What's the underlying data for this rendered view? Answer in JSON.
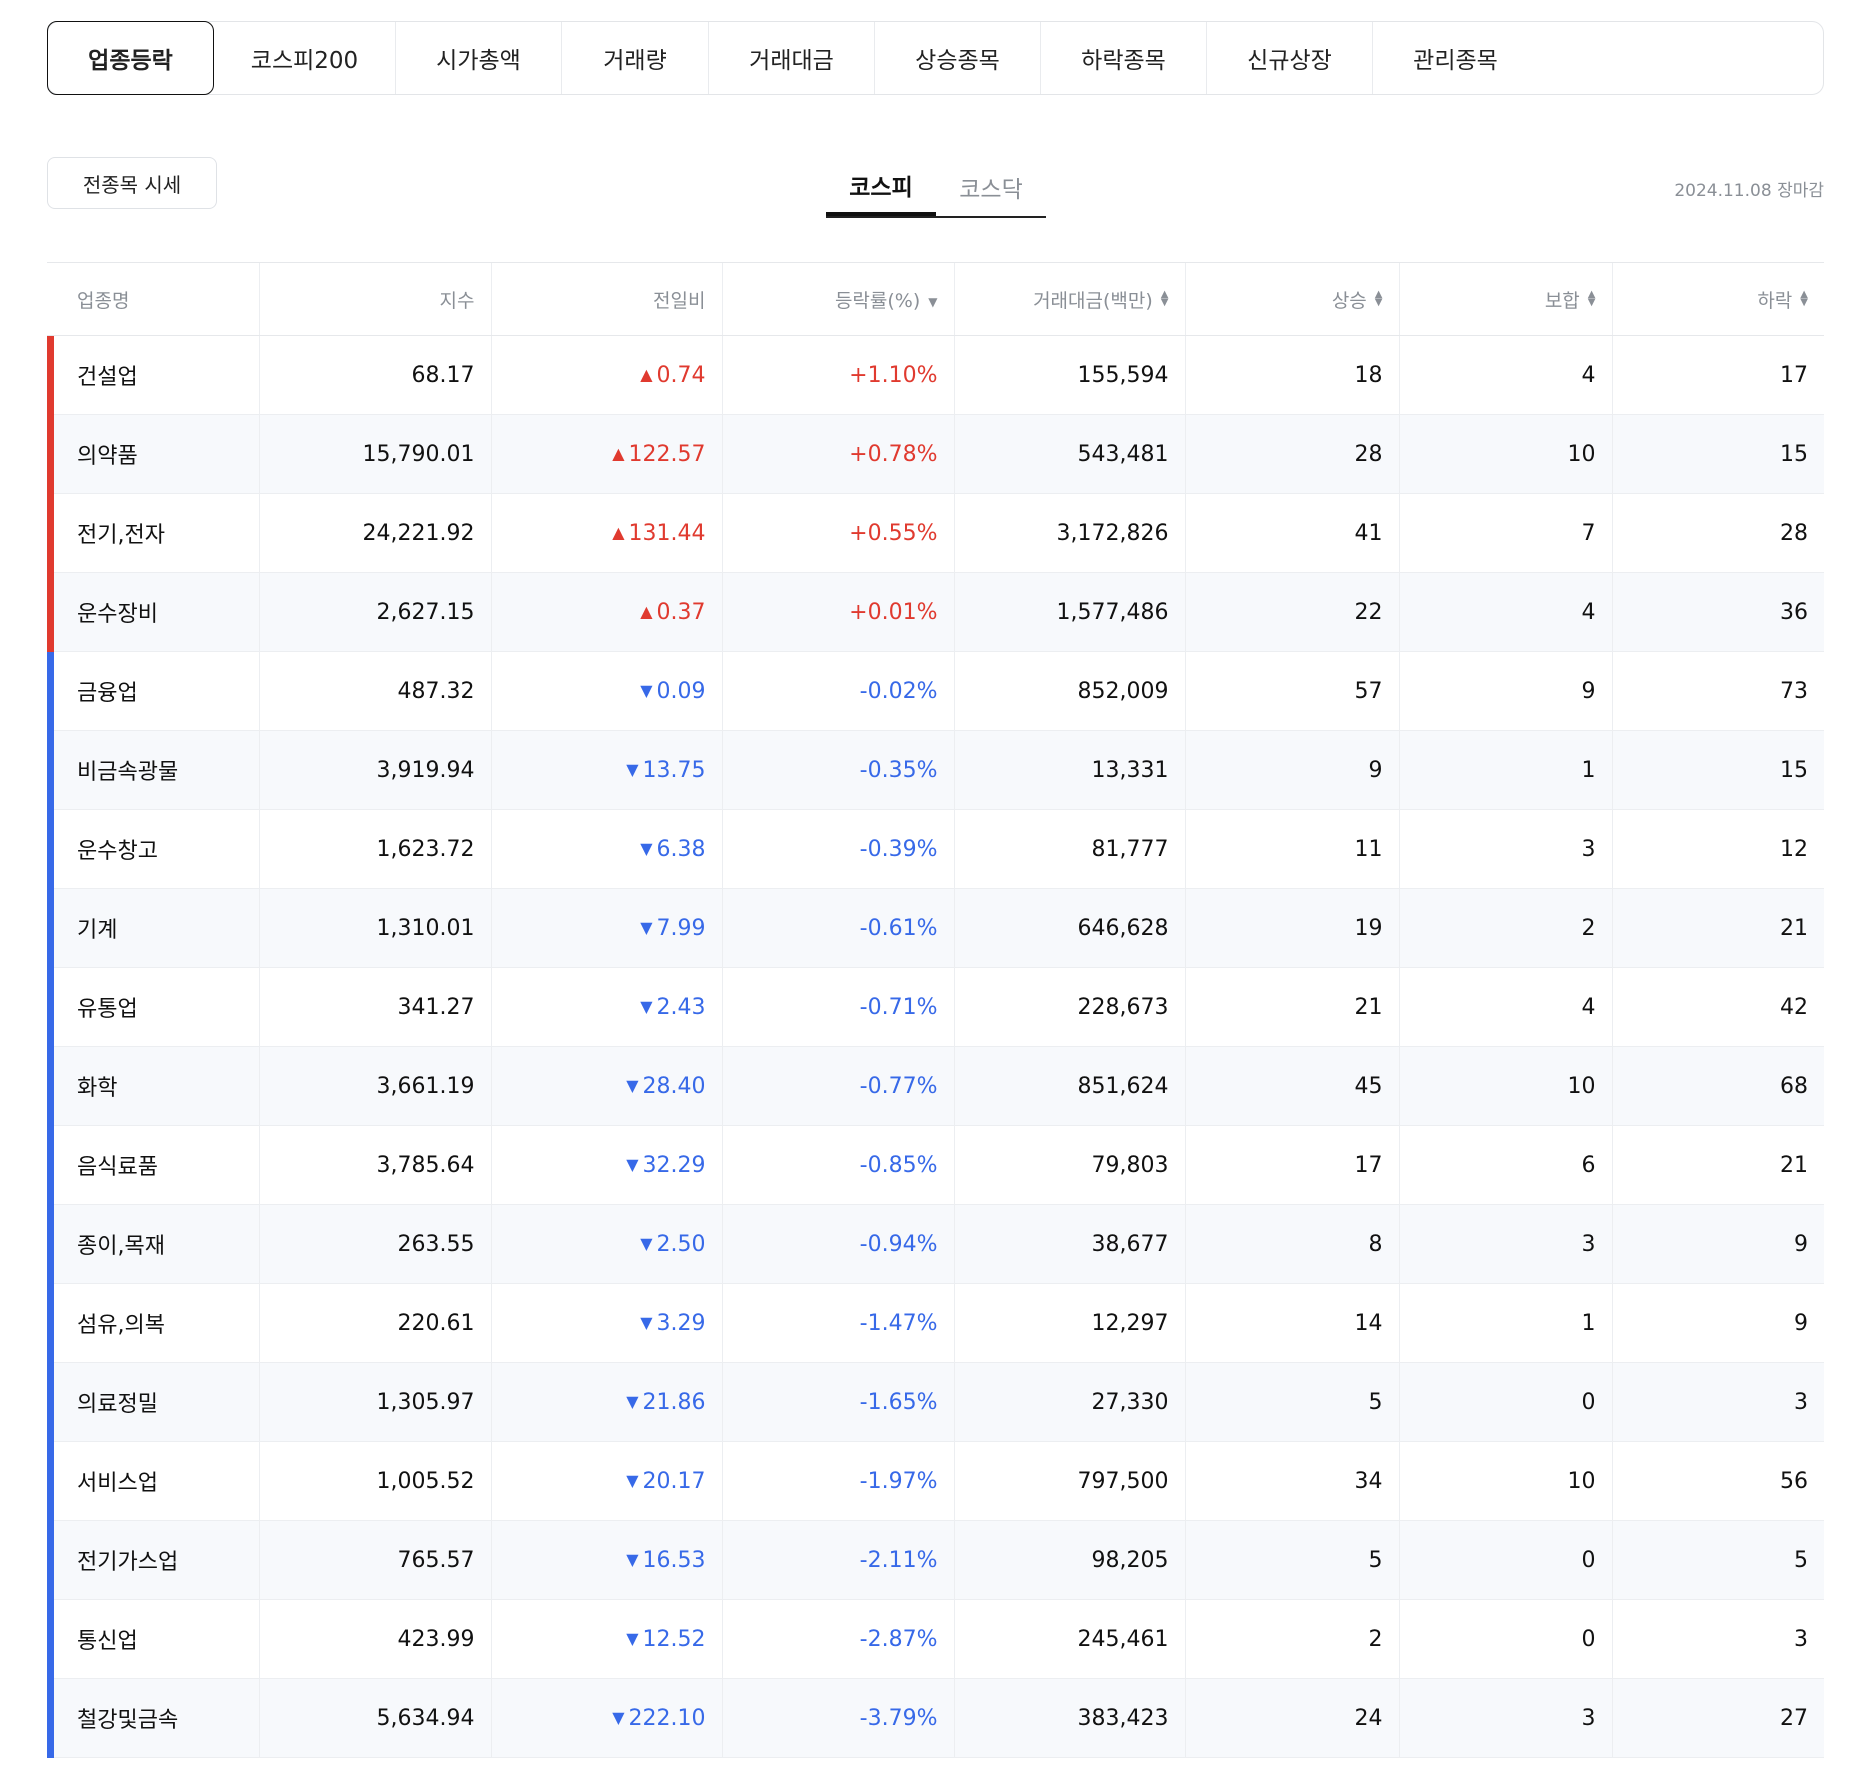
{
  "tabs": [
    "업종등락",
    "코스피200",
    "시가총액",
    "거래량",
    "거래대금",
    "상승종목",
    "하락종목",
    "신규상장",
    "관리종목"
  ],
  "active_tab": 0,
  "all_stocks_button": "전종목 시세",
  "market_tabs": {
    "kospi": "코스피",
    "kosdaq": "코스닥"
  },
  "date_label": "2024.11.08 장마감",
  "colors": {
    "up": "#e03a2f",
    "down": "#3769e8"
  },
  "table": {
    "headers": {
      "name": "업종명",
      "index": "지수",
      "change": "전일비",
      "rate": "등락률(%)",
      "amount": "거래대금(백만)",
      "rise": "상승",
      "flat": "보합",
      "fall": "하락"
    },
    "rows": [
      {
        "name": "건설업",
        "index": "68.17",
        "dir": "up",
        "change": "0.74",
        "rate": "+1.10%",
        "amount": "155,594",
        "rise": "18",
        "flat": "4",
        "fall": "17"
      },
      {
        "name": "의약품",
        "index": "15,790.01",
        "dir": "up",
        "change": "122.57",
        "rate": "+0.78%",
        "amount": "543,481",
        "rise": "28",
        "flat": "10",
        "fall": "15"
      },
      {
        "name": "전기,전자",
        "index": "24,221.92",
        "dir": "up",
        "change": "131.44",
        "rate": "+0.55%",
        "amount": "3,172,826",
        "rise": "41",
        "flat": "7",
        "fall": "28"
      },
      {
        "name": "운수장비",
        "index": "2,627.15",
        "dir": "up",
        "change": "0.37",
        "rate": "+0.01%",
        "amount": "1,577,486",
        "rise": "22",
        "flat": "4",
        "fall": "36"
      },
      {
        "name": "금융업",
        "index": "487.32",
        "dir": "down",
        "change": "0.09",
        "rate": "-0.02%",
        "amount": "852,009",
        "rise": "57",
        "flat": "9",
        "fall": "73"
      },
      {
        "name": "비금속광물",
        "index": "3,919.94",
        "dir": "down",
        "change": "13.75",
        "rate": "-0.35%",
        "amount": "13,331",
        "rise": "9",
        "flat": "1",
        "fall": "15"
      },
      {
        "name": "운수창고",
        "index": "1,623.72",
        "dir": "down",
        "change": "6.38",
        "rate": "-0.39%",
        "amount": "81,777",
        "rise": "11",
        "flat": "3",
        "fall": "12"
      },
      {
        "name": "기계",
        "index": "1,310.01",
        "dir": "down",
        "change": "7.99",
        "rate": "-0.61%",
        "amount": "646,628",
        "rise": "19",
        "flat": "2",
        "fall": "21"
      },
      {
        "name": "유통업",
        "index": "341.27",
        "dir": "down",
        "change": "2.43",
        "rate": "-0.71%",
        "amount": "228,673",
        "rise": "21",
        "flat": "4",
        "fall": "42"
      },
      {
        "name": "화학",
        "index": "3,661.19",
        "dir": "down",
        "change": "28.40",
        "rate": "-0.77%",
        "amount": "851,624",
        "rise": "45",
        "flat": "10",
        "fall": "68"
      },
      {
        "name": "음식료품",
        "index": "3,785.64",
        "dir": "down",
        "change": "32.29",
        "rate": "-0.85%",
        "amount": "79,803",
        "rise": "17",
        "flat": "6",
        "fall": "21"
      },
      {
        "name": "종이,목재",
        "index": "263.55",
        "dir": "down",
        "change": "2.50",
        "rate": "-0.94%",
        "amount": "38,677",
        "rise": "8",
        "flat": "3",
        "fall": "9"
      },
      {
        "name": "섬유,의복",
        "index": "220.61",
        "dir": "down",
        "change": "3.29",
        "rate": "-1.47%",
        "amount": "12,297",
        "rise": "14",
        "flat": "1",
        "fall": "9"
      },
      {
        "name": "의료정밀",
        "index": "1,305.97",
        "dir": "down",
        "change": "21.86",
        "rate": "-1.65%",
        "amount": "27,330",
        "rise": "5",
        "flat": "0",
        "fall": "3"
      },
      {
        "name": "서비스업",
        "index": "1,005.52",
        "dir": "down",
        "change": "20.17",
        "rate": "-1.97%",
        "amount": "797,500",
        "rise": "34",
        "flat": "10",
        "fall": "56"
      },
      {
        "name": "전기가스업",
        "index": "765.57",
        "dir": "down",
        "change": "16.53",
        "rate": "-2.11%",
        "amount": "98,205",
        "rise": "5",
        "flat": "0",
        "fall": "5"
      },
      {
        "name": "통신업",
        "index": "423.99",
        "dir": "down",
        "change": "12.52",
        "rate": "-2.87%",
        "amount": "245,461",
        "rise": "2",
        "flat": "0",
        "fall": "3"
      },
      {
        "name": "철강및금속",
        "index": "5,634.94",
        "dir": "down",
        "change": "222.10",
        "rate": "-3.79%",
        "amount": "383,423",
        "rise": "24",
        "flat": "3",
        "fall": "27"
      }
    ]
  }
}
